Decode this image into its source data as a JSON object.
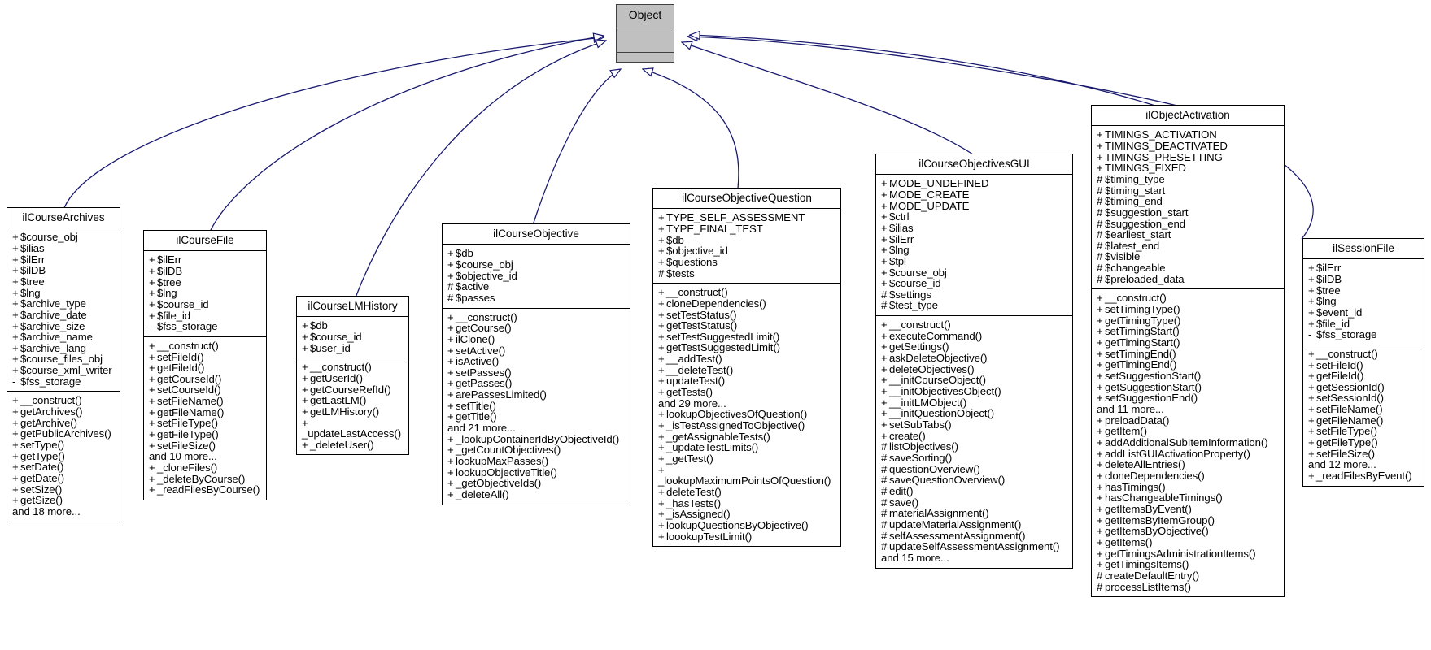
{
  "diagram": {
    "type": "uml-class-inheritance",
    "root": {
      "name": "Object",
      "attributes": [],
      "methods": []
    },
    "edge_color": "#191970",
    "classes": [
      {
        "id": "ilCourseArchives",
        "name": "ilCourseArchives",
        "attributes": [
          "+ $course_obj",
          "+ $ilias",
          "+ $ilErr",
          "+ $ilDB",
          "+ $tree",
          "+ $lng",
          "+ $archive_type",
          "+ $archive_date",
          "+ $archive_size",
          "+ $archive_name",
          "+ $archive_lang",
          "+ $course_files_obj",
          "+ $course_xml_writer",
          "- $fss_storage"
        ],
        "methods": [
          "+ __construct()",
          "+ getArchives()",
          "+ getArchive()",
          "+ getPublicArchives()",
          "+ setType()",
          "+ getType()",
          "+ setDate()",
          "+ getDate()",
          "+ setSize()",
          "+ getSize()",
          "and 18 more..."
        ]
      },
      {
        "id": "ilCourseFile",
        "name": "ilCourseFile",
        "attributes": [
          "+ $ilErr",
          "+ $ilDB",
          "+ $tree",
          "+ $lng",
          "+ $course_id",
          "+ $file_id",
          "- $fss_storage"
        ],
        "methods": [
          "+ __construct()",
          "+ setFileId()",
          "+ getFileId()",
          "+ getCourseId()",
          "+ setCourseId()",
          "+ setFileName()",
          "+ getFileName()",
          "+ setFileType()",
          "+ getFileType()",
          "+ setFileSize()",
          "and 10 more...",
          "+ _cloneFiles()",
          "+ _deleteByCourse()",
          "+ _readFilesByCourse()"
        ]
      },
      {
        "id": "ilCourseLMHistory",
        "name": "ilCourseLMHistory",
        "attributes": [
          "+ $db",
          "+ $course_id",
          "+ $user_id"
        ],
        "methods": [
          "+ __construct()",
          "+ getUserId()",
          "+ getCourseRefId()",
          "+ getLastLM()",
          "+ getLMHistory()",
          "+ _updateLastAccess()",
          "+ _deleteUser()"
        ]
      },
      {
        "id": "ilCourseObjective",
        "name": "ilCourseObjective",
        "attributes": [
          "+ $db",
          "+ $course_obj",
          "+ $objective_id",
          "# $active",
          "# $passes"
        ],
        "methods": [
          "+ __construct()",
          "+ getCourse()",
          "+ ilClone()",
          "+ setActive()",
          "+ isActive()",
          "+ setPasses()",
          "+ getPasses()",
          "+ arePassesLimited()",
          "+ setTitle()",
          "+ getTitle()",
          "and 21 more...",
          "+ _lookupContainerIdByObjectiveId()",
          "+ _getCountObjectives()",
          "+ lookupMaxPasses()",
          "+ lookupObjectiveTitle()",
          "+ _getObjectiveIds()",
          "+ _deleteAll()"
        ]
      },
      {
        "id": "ilCourseObjectiveQuestion",
        "name": "ilCourseObjectiveQuestion",
        "attributes": [
          "+ TYPE_SELF_ASSESSMENT",
          "+ TYPE_FINAL_TEST",
          "+ $db",
          "+ $objective_id",
          "+ $questions",
          "# $tests"
        ],
        "methods": [
          "+ __construct()",
          "+ cloneDependencies()",
          "+ setTestStatus()",
          "+ getTestStatus()",
          "+ setTestSuggestedLimit()",
          "+ getTestSuggestedLimit()",
          "+ __addTest()",
          "+ __deleteTest()",
          "+ updateTest()",
          "+ getTests()",
          "and 29 more...",
          "+ lookupObjectivesOfQuestion()",
          "+ _isTestAssignedToObjective()",
          "+ _getAssignableTests()",
          "+ _updateTestLimits()",
          "+ _getTest()",
          "+ _lookupMaximumPointsOfQuestion()",
          "+ deleteTest()",
          "+ _hasTests()",
          "+ _isAssigned()",
          "+ lookupQuestionsByObjective()",
          "+ loookupTestLimit()"
        ]
      },
      {
        "id": "ilCourseObjectivesGUI",
        "name": "ilCourseObjectivesGUI",
        "attributes": [
          "+ MODE_UNDEFINED",
          "+ MODE_CREATE",
          "+ MODE_UPDATE",
          "+ $ctrl",
          "+ $ilias",
          "+ $ilErr",
          "+ $lng",
          "+ $tpl",
          "+ $course_obj",
          "+ $course_id",
          "# $settings",
          "# $test_type"
        ],
        "methods": [
          "+ __construct()",
          "+ executeCommand()",
          "+ getSettings()",
          "+ askDeleteObjective()",
          "+ deleteObjectives()",
          "+ __initCourseObject()",
          "+ __initObjectivesObject()",
          "+ __initLMObject()",
          "+ __initQuestionObject()",
          "+ setSubTabs()",
          "+ create()",
          "# listObjectives()",
          "# saveSorting()",
          "# questionOverview()",
          "# saveQuestionOverview()",
          "# edit()",
          "# save()",
          "# materialAssignment()",
          "# updateMaterialAssignment()",
          "# selfAssessmentAssignment()",
          "# updateSelfAssessmentAssignment()",
          "and 15 more..."
        ]
      },
      {
        "id": "ilObjectActivation",
        "name": "ilObjectActivation",
        "attributes": [
          "+ TIMINGS_ACTIVATION",
          "+ TIMINGS_DEACTIVATED",
          "+ TIMINGS_PRESETTING",
          "+ TIMINGS_FIXED",
          "# $timing_type",
          "# $timing_start",
          "# $timing_end",
          "# $suggestion_start",
          "# $suggestion_end",
          "# $earliest_start",
          "# $latest_end",
          "# $visible",
          "# $changeable",
          "# $preloaded_data"
        ],
        "methods": [
          "+ __construct()",
          "+ setTimingType()",
          "+ getTimingType()",
          "+ setTimingStart()",
          "+ getTimingStart()",
          "+ setTimingEnd()",
          "+ getTimingEnd()",
          "+ setSuggestionStart()",
          "+ getSuggestionStart()",
          "+ setSuggestionEnd()",
          "and 11 more...",
          "+ preloadData()",
          "+ getItem()",
          "+ addAdditionalSubItemInformation()",
          "+ addListGUIActivationProperty()",
          "+ deleteAllEntries()",
          "+ cloneDependencies()",
          "+ hasTimings()",
          "+ hasChangeableTimings()",
          "+ getItemsByEvent()",
          "+ getItemsByItemGroup()",
          "+ getItemsByObjective()",
          "+ getItems()",
          "+ getTimingsAdministrationItems()",
          "+ getTimingsItems()",
          "# createDefaultEntry()",
          "# processListItems()"
        ]
      },
      {
        "id": "ilSessionFile",
        "name": "ilSessionFile",
        "attributes": [
          "+ $ilErr",
          "+ $ilDB",
          "+ $tree",
          "+ $lng",
          "+ $event_id",
          "+ $file_id",
          "- $fss_storage"
        ],
        "methods": [
          "+ __construct()",
          "+ setFileId()",
          "+ getFileId()",
          "+ getSessionId()",
          "+ setSessionId()",
          "+ setFileName()",
          "+ getFileName()",
          "+ setFileType()",
          "+ getFileType()",
          "+ setFileSize()",
          "and 12 more...",
          "+ _readFilesByEvent()"
        ]
      }
    ]
  }
}
